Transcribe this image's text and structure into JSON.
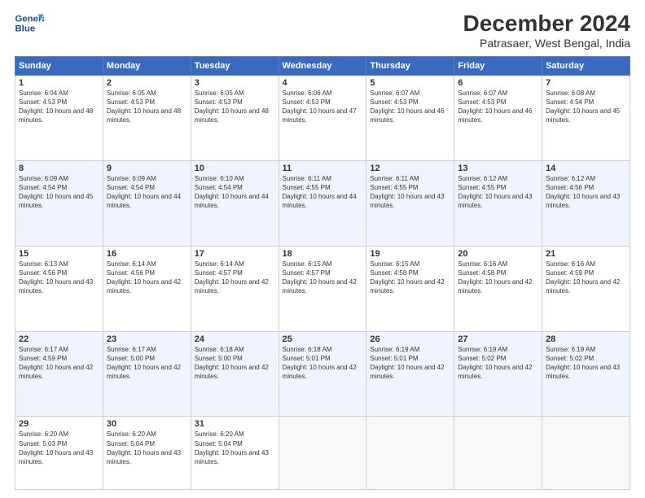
{
  "header": {
    "logo_line1": "General",
    "logo_line2": "Blue",
    "title": "December 2024",
    "subtitle": "Patrasaer, West Bengal, India"
  },
  "weekdays": [
    "Sunday",
    "Monday",
    "Tuesday",
    "Wednesday",
    "Thursday",
    "Friday",
    "Saturday"
  ],
  "weeks": [
    [
      {
        "day": "1",
        "sunrise": "6:04 AM",
        "sunset": "4:53 PM",
        "daylight": "10 hours and 48 minutes."
      },
      {
        "day": "2",
        "sunrise": "6:05 AM",
        "sunset": "4:53 PM",
        "daylight": "10 hours and 48 minutes."
      },
      {
        "day": "3",
        "sunrise": "6:05 AM",
        "sunset": "4:53 PM",
        "daylight": "10 hours and 48 minutes."
      },
      {
        "day": "4",
        "sunrise": "6:06 AM",
        "sunset": "4:53 PM",
        "daylight": "10 hours and 47 minutes."
      },
      {
        "day": "5",
        "sunrise": "6:07 AM",
        "sunset": "4:53 PM",
        "daylight": "10 hours and 46 minutes."
      },
      {
        "day": "6",
        "sunrise": "6:07 AM",
        "sunset": "4:53 PM",
        "daylight": "10 hours and 46 minutes."
      },
      {
        "day": "7",
        "sunrise": "6:08 AM",
        "sunset": "4:54 PM",
        "daylight": "10 hours and 45 minutes."
      }
    ],
    [
      {
        "day": "8",
        "sunrise": "6:09 AM",
        "sunset": "4:54 PM",
        "daylight": "10 hours and 45 minutes."
      },
      {
        "day": "9",
        "sunrise": "6:09 AM",
        "sunset": "4:54 PM",
        "daylight": "10 hours and 44 minutes."
      },
      {
        "day": "10",
        "sunrise": "6:10 AM",
        "sunset": "4:54 PM",
        "daylight": "10 hours and 44 minutes."
      },
      {
        "day": "11",
        "sunrise": "6:11 AM",
        "sunset": "4:55 PM",
        "daylight": "10 hours and 44 minutes."
      },
      {
        "day": "12",
        "sunrise": "6:11 AM",
        "sunset": "4:55 PM",
        "daylight": "10 hours and 43 minutes."
      },
      {
        "day": "13",
        "sunrise": "6:12 AM",
        "sunset": "4:55 PM",
        "daylight": "10 hours and 43 minutes."
      },
      {
        "day": "14",
        "sunrise": "6:12 AM",
        "sunset": "4:56 PM",
        "daylight": "10 hours and 43 minutes."
      }
    ],
    [
      {
        "day": "15",
        "sunrise": "6:13 AM",
        "sunset": "4:56 PM",
        "daylight": "10 hours and 43 minutes."
      },
      {
        "day": "16",
        "sunrise": "6:14 AM",
        "sunset": "4:56 PM",
        "daylight": "10 hours and 42 minutes."
      },
      {
        "day": "17",
        "sunrise": "6:14 AM",
        "sunset": "4:57 PM",
        "daylight": "10 hours and 42 minutes."
      },
      {
        "day": "18",
        "sunrise": "6:15 AM",
        "sunset": "4:57 PM",
        "daylight": "10 hours and 42 minutes."
      },
      {
        "day": "19",
        "sunrise": "6:15 AM",
        "sunset": "4:58 PM",
        "daylight": "10 hours and 42 minutes."
      },
      {
        "day": "20",
        "sunrise": "6:16 AM",
        "sunset": "4:58 PM",
        "daylight": "10 hours and 42 minutes."
      },
      {
        "day": "21",
        "sunrise": "6:16 AM",
        "sunset": "4:59 PM",
        "daylight": "10 hours and 42 minutes."
      }
    ],
    [
      {
        "day": "22",
        "sunrise": "6:17 AM",
        "sunset": "4:59 PM",
        "daylight": "10 hours and 42 minutes."
      },
      {
        "day": "23",
        "sunrise": "6:17 AM",
        "sunset": "5:00 PM",
        "daylight": "10 hours and 42 minutes."
      },
      {
        "day": "24",
        "sunrise": "6:18 AM",
        "sunset": "5:00 PM",
        "daylight": "10 hours and 42 minutes."
      },
      {
        "day": "25",
        "sunrise": "6:18 AM",
        "sunset": "5:01 PM",
        "daylight": "10 hours and 42 minutes."
      },
      {
        "day": "26",
        "sunrise": "6:19 AM",
        "sunset": "5:01 PM",
        "daylight": "10 hours and 42 minutes."
      },
      {
        "day": "27",
        "sunrise": "6:19 AM",
        "sunset": "5:02 PM",
        "daylight": "10 hours and 42 minutes."
      },
      {
        "day": "28",
        "sunrise": "6:19 AM",
        "sunset": "5:02 PM",
        "daylight": "10 hours and 43 minutes."
      }
    ],
    [
      {
        "day": "29",
        "sunrise": "6:20 AM",
        "sunset": "5:03 PM",
        "daylight": "10 hours and 43 minutes."
      },
      {
        "day": "30",
        "sunrise": "6:20 AM",
        "sunset": "5:04 PM",
        "daylight": "10 hours and 43 minutes."
      },
      {
        "day": "31",
        "sunrise": "6:20 AM",
        "sunset": "5:04 PM",
        "daylight": "10 hours and 43 minutes."
      },
      null,
      null,
      null,
      null
    ]
  ]
}
